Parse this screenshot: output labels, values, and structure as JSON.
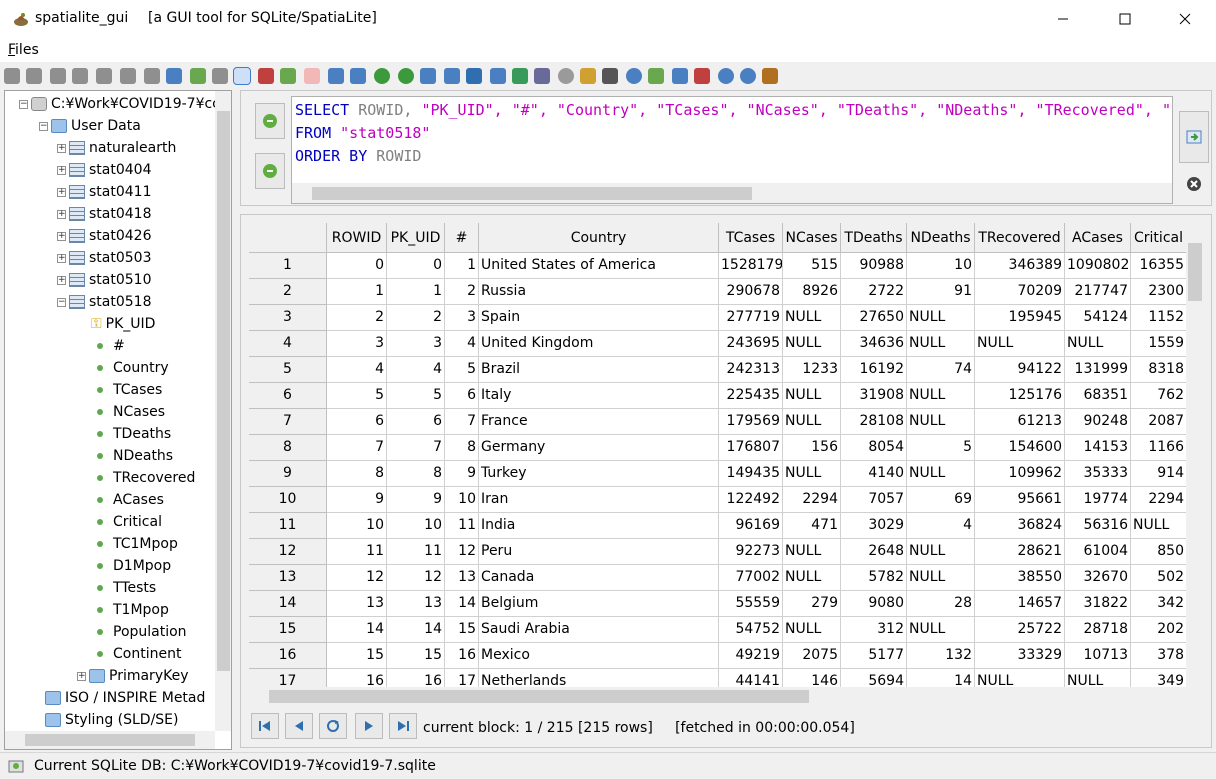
{
  "window": {
    "app": "spatialite_gui",
    "description": "[a GUI tool for SQLite/SpatiaLite]"
  },
  "menu": {
    "files_prefix": "F",
    "files_rest": "iles"
  },
  "tree": {
    "root": "C:¥Work¥COVID19-7¥cc",
    "user_data": "User Data",
    "items": [
      "naturalearth",
      "stat0404",
      "stat0411",
      "stat0418",
      "stat0426",
      "stat0503",
      "stat0510",
      "stat0518"
    ],
    "key_column": "PK_UID",
    "columns": [
      "#",
      "Country",
      "TCases",
      "NCases",
      "TDeaths",
      "NDeaths",
      "TRecovered",
      "ACases",
      "Critical",
      "TC1Mpop",
      "D1Mpop",
      "TTests",
      "T1Mpop",
      "Population",
      "Continent"
    ],
    "primary_key": "PrimaryKey",
    "iso": "ISO / INSPIRE Metad",
    "styling": "Styling (SLD/SE)"
  },
  "sql": {
    "kw_select": "SELECT",
    "ids_line1": " ROWID, ",
    "strs_line1": "\"PK_UID\", \"#\", \"Country\", \"TCases\", \"NCases\", \"TDeaths\", \"NDeaths\", \"TRecovered\", \"",
    "kw_from": "FROM",
    "from_table": " \"stat0518\"",
    "kw_order": "ORDER BY",
    "order_col": " ROWID"
  },
  "grid": {
    "headers": [
      "",
      "ROWID",
      "PK_UID",
      "#",
      "Country",
      "TCases",
      "NCases",
      "TDeaths",
      "NDeaths",
      "TRecovered",
      "ACases",
      "Critical"
    ],
    "rows": [
      [
        "1",
        "0",
        "0",
        "1",
        "United States of America",
        "1528179",
        "515",
        "90988",
        "10",
        "346389",
        "1090802",
        "16355"
      ],
      [
        "2",
        "1",
        "1",
        "2",
        "Russia",
        "290678",
        "8926",
        "2722",
        "91",
        "70209",
        "217747",
        "2300"
      ],
      [
        "3",
        "2",
        "2",
        "3",
        "Spain",
        "277719",
        "NULL",
        "27650",
        "NULL",
        "195945",
        "54124",
        "1152"
      ],
      [
        "4",
        "3",
        "3",
        "4",
        "United Kingdom",
        "243695",
        "NULL",
        "34636",
        "NULL",
        "NULL",
        "NULL",
        "1559"
      ],
      [
        "5",
        "4",
        "4",
        "5",
        "Brazil",
        "242313",
        "1233",
        "16192",
        "74",
        "94122",
        "131999",
        "8318"
      ],
      [
        "6",
        "5",
        "5",
        "6",
        "Italy",
        "225435",
        "NULL",
        "31908",
        "NULL",
        "125176",
        "68351",
        "762"
      ],
      [
        "7",
        "6",
        "6",
        "7",
        "France",
        "179569",
        "NULL",
        "28108",
        "NULL",
        "61213",
        "90248",
        "2087"
      ],
      [
        "8",
        "7",
        "7",
        "8",
        "Germany",
        "176807",
        "156",
        "8054",
        "5",
        "154600",
        "14153",
        "1166"
      ],
      [
        "9",
        "8",
        "8",
        "9",
        "Turkey",
        "149435",
        "NULL",
        "4140",
        "NULL",
        "109962",
        "35333",
        "914"
      ],
      [
        "10",
        "9",
        "9",
        "10",
        "Iran",
        "122492",
        "2294",
        "7057",
        "69",
        "95661",
        "19774",
        "2294"
      ],
      [
        "11",
        "10",
        "10",
        "11",
        "India",
        "96169",
        "471",
        "3029",
        "4",
        "36824",
        "56316",
        "NULL"
      ],
      [
        "12",
        "11",
        "11",
        "12",
        "Peru",
        "92273",
        "NULL",
        "2648",
        "NULL",
        "28621",
        "61004",
        "850"
      ],
      [
        "13",
        "12",
        "12",
        "13",
        "Canada",
        "77002",
        "NULL",
        "5782",
        "NULL",
        "38550",
        "32670",
        "502"
      ],
      [
        "14",
        "13",
        "13",
        "14",
        "Belgium",
        "55559",
        "279",
        "9080",
        "28",
        "14657",
        "31822",
        "342"
      ],
      [
        "15",
        "14",
        "14",
        "15",
        "Saudi Arabia",
        "54752",
        "NULL",
        "312",
        "NULL",
        "25722",
        "28718",
        "202"
      ],
      [
        "16",
        "15",
        "15",
        "16",
        "Mexico",
        "49219",
        "2075",
        "5177",
        "132",
        "33329",
        "10713",
        "378"
      ],
      [
        "17",
        "16",
        "16",
        "17",
        "Netherlands",
        "44141",
        "146",
        "5694",
        "14",
        "NULL",
        "NULL",
        "349"
      ]
    ]
  },
  "nav": {
    "status": "current block: 1 / 215 [215 rows]     [fetched in 00:00:00.054]"
  },
  "status": {
    "text": "Current SQLite DB: C:¥Work¥COVID19-7¥covid19-7.sqlite"
  }
}
